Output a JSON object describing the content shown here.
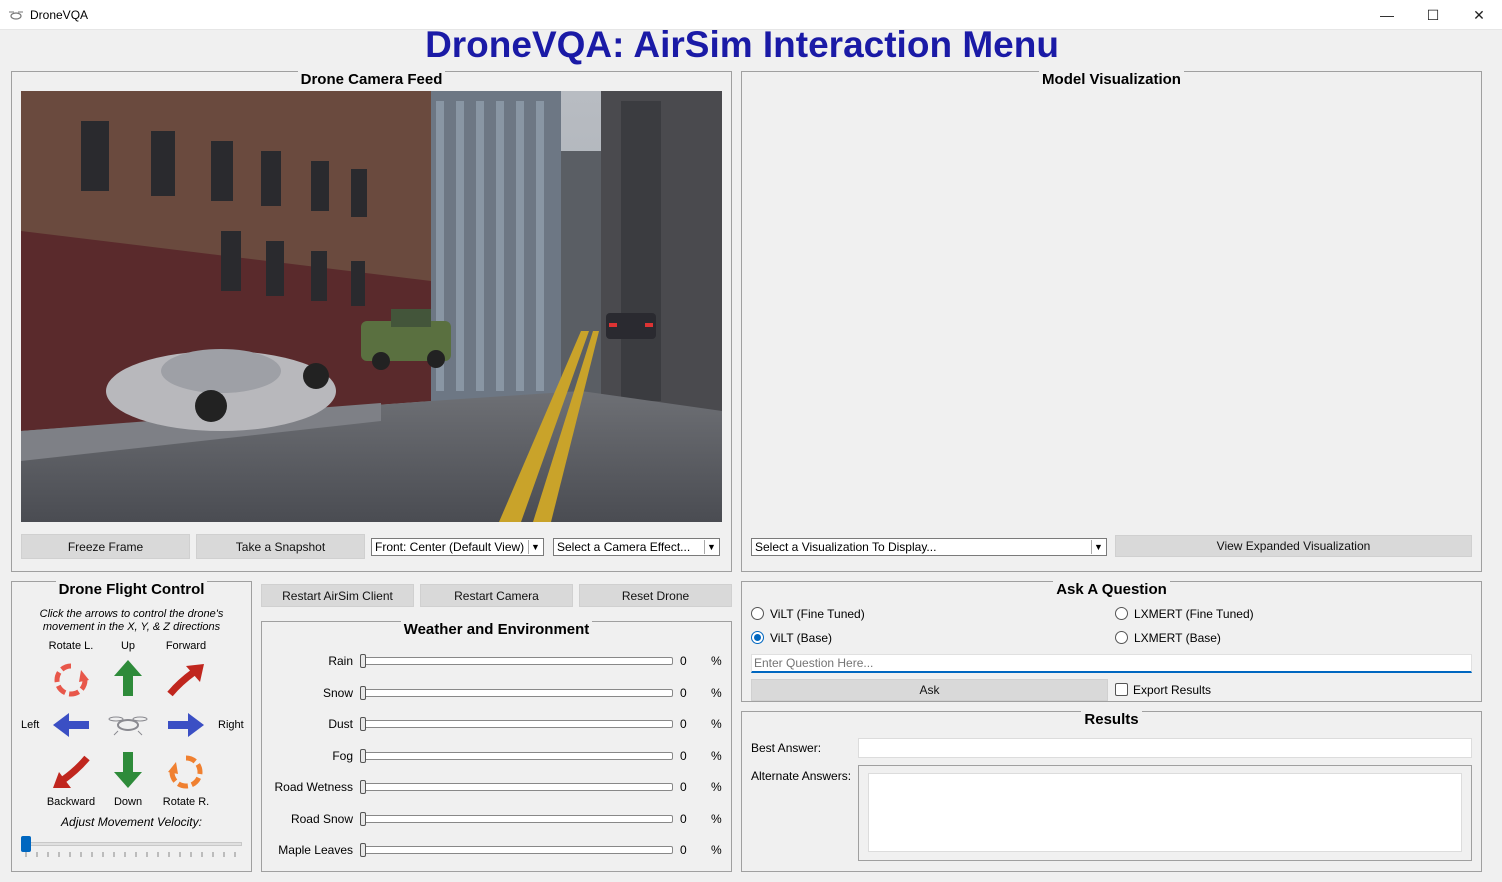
{
  "window": {
    "title": "DroneVQA",
    "minimize": "—",
    "maximize": "☐",
    "close": "✕"
  },
  "header": {
    "title": "DroneVQA: AirSim Interaction Menu"
  },
  "camera_panel": {
    "title": "Drone Camera Feed",
    "freeze_label": "Freeze Frame",
    "snapshot_label": "Take a Snapshot",
    "view_select": "Front: Center (Default View)",
    "effect_select": "Select a Camera Effect..."
  },
  "visualization_panel": {
    "title": "Model Visualization",
    "select": "Select a Visualization To Display...",
    "expand_label": "View Expanded Visualization"
  },
  "flight_control": {
    "title": "Drone Flight Control",
    "instructions": "Click the arrows to control the drone's movement in the X, Y, & Z directions",
    "labels": {
      "rotate_left": "Rotate L.",
      "up": "Up",
      "forward": "Forward",
      "left": "Left",
      "right": "Right",
      "backward": "Backward",
      "down": "Down",
      "rotate_right": "Rotate R."
    },
    "velocity_label": "Adjust Movement Velocity:",
    "velocity_value": 0
  },
  "actions": {
    "restart_client": "Restart AirSim Client",
    "restart_camera": "Restart Camera",
    "reset_drone": "Reset Drone"
  },
  "weather": {
    "title": "Weather and Environment",
    "unit": "%",
    "items": [
      {
        "label": "Rain",
        "value": "0"
      },
      {
        "label": "Snow",
        "value": "0"
      },
      {
        "label": "Dust",
        "value": "0"
      },
      {
        "label": "Fog",
        "value": "0"
      },
      {
        "label": "Road Wetness",
        "value": "0"
      },
      {
        "label": "Road Snow",
        "value": "0"
      },
      {
        "label": "Maple Leaves",
        "value": "0"
      }
    ]
  },
  "question": {
    "title": "Ask A Question",
    "options": [
      {
        "label": "ViLT (Fine Tuned)",
        "selected": false
      },
      {
        "label": "LXMERT (Fine Tuned)",
        "selected": false
      },
      {
        "label": "ViLT (Base)",
        "selected": true
      },
      {
        "label": "LXMERT (Base)",
        "selected": false
      }
    ],
    "placeholder": "Enter Question Here...",
    "ask_label": "Ask",
    "export_label": "Export Results",
    "export_checked": false
  },
  "results": {
    "title": "Results",
    "best_label": "Best Answer:",
    "alternate_label": "Alternate Answers:"
  },
  "colors": {
    "title_blue": "#1a1aa6",
    "arrow_red": "#c0261e",
    "arrow_green": "#2e8b3a",
    "arrow_blue": "#3b4fc4",
    "arrow_orange": "#f08030",
    "accent": "#0067c0"
  }
}
